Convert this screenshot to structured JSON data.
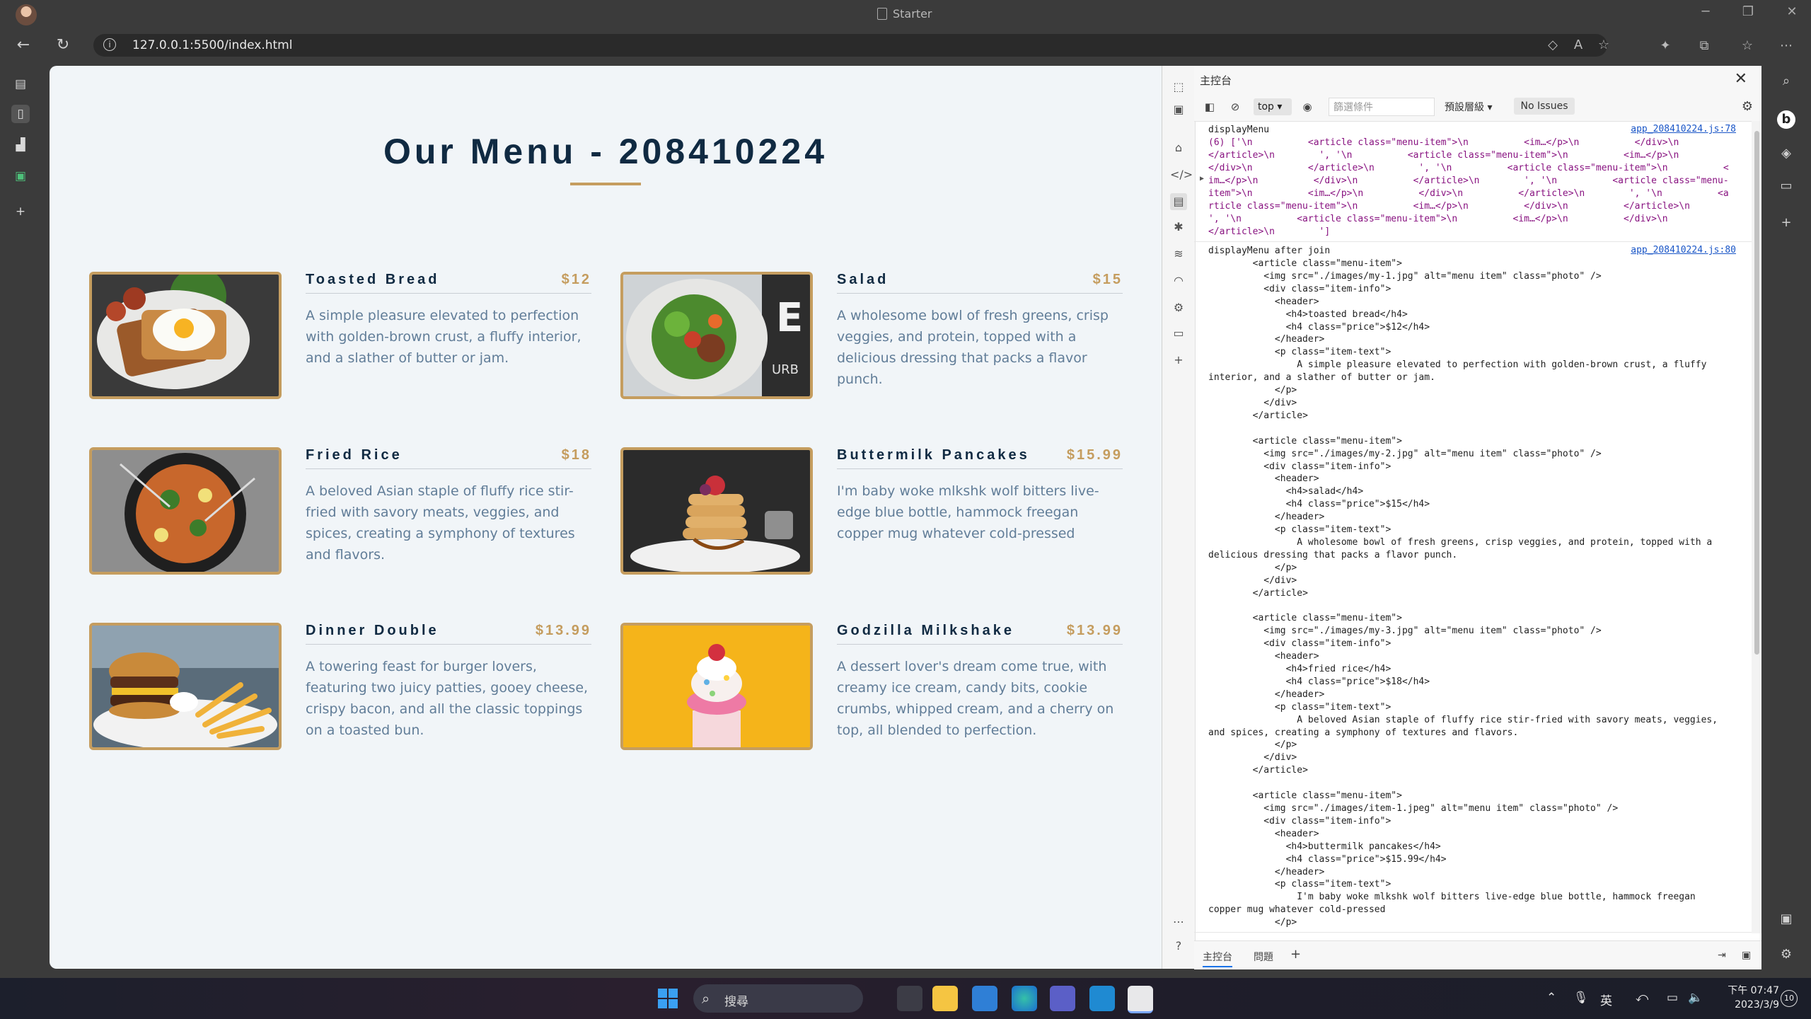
{
  "browser": {
    "tab_title": "Starter",
    "url": "127.0.0.1:5500/index.html"
  },
  "page": {
    "title": "Our Menu - 208410224",
    "items": [
      {
        "name": "Toasted Bread",
        "price": "$12",
        "text": "A simple pleasure elevated to perfection with golden-brown crust, a fluffy interior, and a slather of butter or jam."
      },
      {
        "name": "Salad",
        "price": "$15",
        "text": "A wholesome bowl of fresh greens, crisp veggies, and protein, topped with a delicious dressing that packs a flavor punch."
      },
      {
        "name": "Fried Rice",
        "price": "$18",
        "text": "A beloved Asian staple of fluffy rice stir-fried with savory meats, veggies, and spices, creating a symphony of textures and flavors."
      },
      {
        "name": "Buttermilk Pancakes",
        "price": "$15.99",
        "text": "I'm baby woke mlkshk wolf bitters live-edge blue bottle, hammock freegan copper mug whatever cold-pressed"
      },
      {
        "name": "Dinner Double",
        "price": "$13.99",
        "text": "A towering feast for burger lovers, featuring two juicy patties, gooey cheese, crispy bacon, and all the classic toppings on a toasted bun."
      },
      {
        "name": "Godzilla Milkshake",
        "price": "$13.99",
        "text": "A dessert lover's dream come true, with creamy ice cream, candy bits, cookie crumbs, whipped cream, and a cherry on top, all blended to perfection."
      }
    ],
    "accent": "#c59d5f",
    "title_color": "#102a42",
    "text_color": "#617d98",
    "background": "#f1f5f8"
  },
  "devtools": {
    "panel_title": "主控台",
    "context": "top",
    "filter_placeholder": "篩選條件",
    "level": "預設層級",
    "issues": "No Issues",
    "bottom_tabs": [
      "主控台",
      "問題"
    ],
    "messages": [
      {
        "label": "displayMenu",
        "source": "app_208410224.js:78",
        "array_preview": "(6) ['\\n          <article class=\"menu-item\">\\n          <im…</p>\\n          </div>\\n          </article>\\n        ', '\\n          <article class=\"menu-item\">\\n          <im…</p>\\n          </div>\\n          </article>\\n        ', '\\n          <article class=\"menu-item\">\\n          <im…</p>\\n          </div>\\n          </article>\\n        ', '\\n          <article class=\"menu-item\">\\n          <im…</p>\\n          </div>\\n          </article>\\n        ', '\\n          <article class=\"menu-item\">\\n          <im…</p>\\n          </div>\\n          </article>\\n        ', '\\n          <article class=\"menu-item\">\\n          <im…</p>\\n          </div>\\n          </article>\\n        ']"
      },
      {
        "label": "displayMenu after join",
        "source": "app_208410224.js:80",
        "code": "        <article class=\"menu-item\">\n          <img src=\"./images/my-1.jpg\" alt=\"menu item\" class=\"photo\" />\n          <div class=\"item-info\">\n            <header>\n              <h4>toasted bread</h4>\n              <h4 class=\"price\">$12</h4>\n            </header>\n            <p class=\"item-text\">\n                A simple pleasure elevated to perfection with golden-brown crust, a fluffy interior, and a slather of butter or jam.\n            </p>\n          </div>\n        </article>\n\n        <article class=\"menu-item\">\n          <img src=\"./images/my-2.jpg\" alt=\"menu item\" class=\"photo\" />\n          <div class=\"item-info\">\n            <header>\n              <h4>salad</h4>\n              <h4 class=\"price\">$15</h4>\n            </header>\n            <p class=\"item-text\">\n                A wholesome bowl of fresh greens, crisp veggies, and protein, topped with a delicious dressing that packs a flavor punch.\n            </p>\n          </div>\n        </article>\n\n        <article class=\"menu-item\">\n          <img src=\"./images/my-3.jpg\" alt=\"menu item\" class=\"photo\" />\n          <div class=\"item-info\">\n            <header>\n              <h4>fried rice</h4>\n              <h4 class=\"price\">$18</h4>\n            </header>\n            <p class=\"item-text\">\n                A beloved Asian staple of fluffy rice stir-fried with savory meats, veggies, and spices, creating a symphony of textures and flavors.\n            </p>\n          </div>\n        </article>\n\n        <article class=\"menu-item\">\n          <img src=\"./images/item-1.jpeg\" alt=\"menu item\" class=\"photo\" />\n          <div class=\"item-info\">\n            <header>\n              <h4>buttermilk pancakes</h4>\n              <h4 class=\"price\">$15.99</h4>\n            </header>\n            <p class=\"item-text\">\n                I'm baby woke mlkshk wolf bitters live-edge blue bottle, hammock freegan copper mug whatever cold-pressed\n            </p>"
      }
    ]
  },
  "taskbar": {
    "search_placeholder": "搜尋",
    "ime": "英",
    "time": "下午 07:47",
    "date": "2023/3/9",
    "notifications": "10"
  }
}
